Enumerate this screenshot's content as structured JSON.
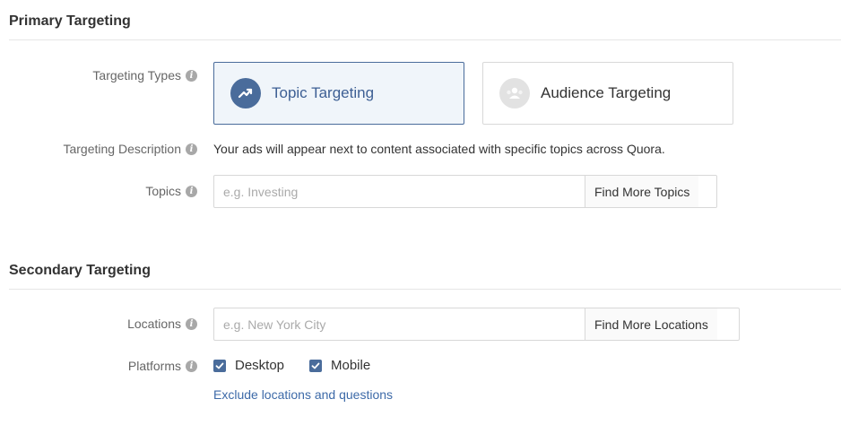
{
  "primary": {
    "title": "Primary Targeting",
    "targeting_types": {
      "label": "Targeting Types",
      "options": [
        {
          "label": "Topic Targeting",
          "selected": true,
          "icon": "trending-up-icon"
        },
        {
          "label": "Audience Targeting",
          "selected": false,
          "icon": "audience-icon"
        }
      ]
    },
    "targeting_description": {
      "label": "Targeting Description",
      "text": "Your ads will appear next to content associated with specific topics across Quora."
    },
    "topics": {
      "label": "Topics",
      "placeholder": "e.g. Investing",
      "value": "",
      "button": "Find More Topics"
    }
  },
  "secondary": {
    "title": "Secondary Targeting",
    "locations": {
      "label": "Locations",
      "placeholder": "e.g. New York City",
      "value": "",
      "button": "Find More Locations"
    },
    "platforms": {
      "label": "Platforms",
      "options": [
        {
          "label": "Desktop",
          "checked": true
        },
        {
          "label": "Mobile",
          "checked": true
        }
      ]
    },
    "exclude_link": "Exclude locations and questions"
  },
  "colors": {
    "accent": "#4a6c9b",
    "link": "#3d6aa8",
    "selected_bg": "#f0f5fa",
    "info_icon": "#a8a8a8"
  }
}
